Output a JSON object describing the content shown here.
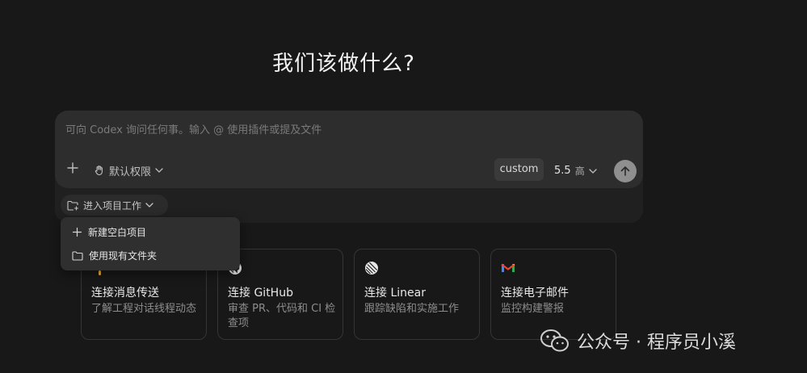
{
  "page": {
    "title": "我们该做什么?"
  },
  "composer": {
    "placeholder": "可向 Codex 询问任何事。输入 @ 使用插件或提及文件",
    "add_icon": "plus-icon",
    "permission": {
      "icon": "hand-icon",
      "label": "默认权限"
    },
    "mode_badge": "custom",
    "model": {
      "version": "5.5",
      "effort": "高"
    },
    "send_icon": "arrow-up-icon"
  },
  "project": {
    "chip_label": "进入项目工作",
    "dropdown": [
      {
        "icon": "plus-icon",
        "label": "新建空白项目"
      },
      {
        "icon": "folder-icon",
        "label": "使用现有文件夹"
      }
    ]
  },
  "cards": [
    {
      "title": "连接消息传送",
      "desc": "了解工程对话线程动态"
    },
    {
      "title": "连接 GitHub",
      "desc": "审查 PR、代码和 CI 检查项"
    },
    {
      "title": "连接 Linear",
      "desc": "跟踪缺陷和实施工作"
    },
    {
      "title": "连接电子邮件",
      "desc": "监控构建警报"
    }
  ],
  "watermark": {
    "text": "公众号 · 程序员小溪"
  }
}
